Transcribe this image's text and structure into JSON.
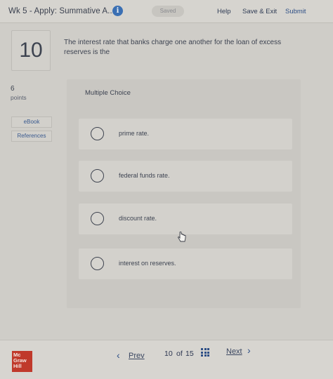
{
  "header": {
    "assignment_title": "Wk 5 - Apply: Summative A...",
    "info_icon": "info-icon",
    "saved_status": "Saved",
    "help": "Help",
    "save_exit": "Save & Exit",
    "submit": "Submit"
  },
  "question": {
    "number": "10",
    "points_value": "6",
    "points_label": "points",
    "text": "The interest rate that banks charge one another for the loan of excess reserves is the",
    "type_label": "Multiple Choice",
    "options": [
      {
        "label": "prime rate."
      },
      {
        "label": "federal funds rate."
      },
      {
        "label": "discount rate."
      },
      {
        "label": "interest on reserves."
      }
    ]
  },
  "sidebar": {
    "ebook": "eBook",
    "references": "References"
  },
  "footer": {
    "logo_text": "Mc Graw Hill",
    "prev": "Prev",
    "current_page": "10",
    "of": "of",
    "total_pages": "15",
    "next": "Next"
  },
  "colors": {
    "accent": "#2e4f86",
    "brand": "#c0392b",
    "info": "#3a6fb3"
  }
}
